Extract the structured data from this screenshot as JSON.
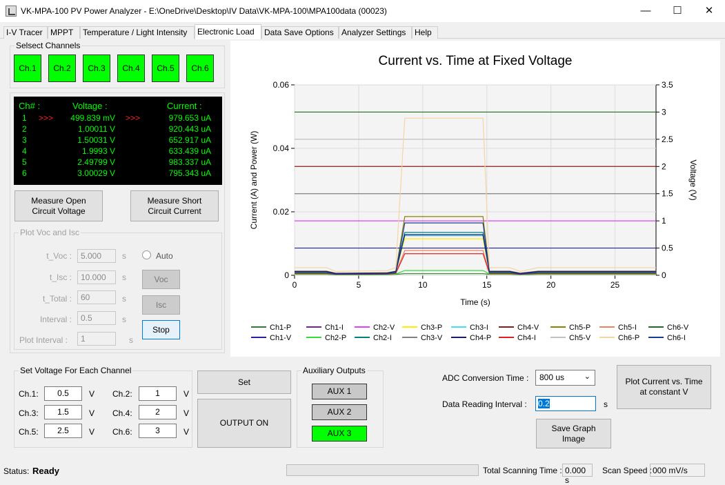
{
  "window": {
    "title": "VK-MPA-100 PV Power Analyzer - E:\\OneDrive\\Desktop\\IV Data\\VK-MPA-100\\MPA100data (00023)",
    "minimize": "—",
    "maximize": "☐",
    "close": "✕"
  },
  "tabs": [
    "I-V Tracer",
    "MPPT",
    "Temperature / Light Intensity",
    "Electronic Load",
    "Data Save Options",
    "Analyzer Settings",
    "Help"
  ],
  "active_tab": "Electronic Load",
  "channels": {
    "label": "Selsect Channels",
    "buttons": [
      "Ch.1",
      "Ch.2",
      "Ch.3",
      "Ch.4",
      "Ch.5",
      "Ch.6"
    ],
    "color": "#00ff00"
  },
  "readout": {
    "headers": {
      "ch": "Ch# :",
      "voltage": "Voltage :",
      "current": "Current :"
    },
    "rows": [
      {
        "ch": "1",
        "voltage": "499.839 mV",
        "current": "979.653 uA",
        "arrow_left": ">>>",
        "arrow_right": ">>>"
      },
      {
        "ch": "2",
        "voltage": "1.00011 V",
        "current": "920.443 uA"
      },
      {
        "ch": "3",
        "voltage": "1.50031 V",
        "current": "652.917 uA"
      },
      {
        "ch": "4",
        "voltage": "1.9993 V",
        "current": "633.439 uA"
      },
      {
        "ch": "5",
        "voltage": "2.49799 V",
        "current": "983.337 uA"
      },
      {
        "ch": "6",
        "voltage": "3.00029 V",
        "current": "795.343 uA"
      }
    ]
  },
  "measure": {
    "voc_line1": "Measure Open",
    "voc_line2": "Circuit Voltage",
    "isc_line1": "Measure Short",
    "isc_line2": "Circuit Current"
  },
  "plot_voc_isc": {
    "label": "Plot Voc and Isc",
    "t_voc_label": "t_Voc :",
    "t_voc": "5.000",
    "t_isc_label": "t_Isc :",
    "t_isc": "10.000",
    "t_total_label": "t_Total :",
    "t_total": "60",
    "interval_label": "Interval :",
    "interval": "0.5",
    "plot_interval_label": "Plot Interval :",
    "plot_interval": "1",
    "unit": "s",
    "auto_label": "Auto",
    "voc_button": "Voc",
    "isc_button": "Isc",
    "stop_button": "Stop"
  },
  "set_voltage": {
    "label": "Set Voltage For Each Channel",
    "unit": "V",
    "channels": [
      {
        "label": "Ch.1:",
        "value": "0.5"
      },
      {
        "label": "Ch.2:",
        "value": "1"
      },
      {
        "label": "Ch.3:",
        "value": "1.5"
      },
      {
        "label": "Ch.4:",
        "value": "2"
      },
      {
        "label": "Ch.5:",
        "value": "2.5"
      },
      {
        "label": "Ch.6:",
        "value": "3"
      }
    ]
  },
  "set_button": "Set",
  "output_button": "OUTPUT ON",
  "aux": {
    "label": "Auxiliary Outputs",
    "buttons": [
      "AUX 1",
      "AUX 2",
      "AUX 3"
    ],
    "active": "AUX 3"
  },
  "adc": {
    "label": "ADC Conversion Time :",
    "value": "800 us",
    "interval_label": "Data Reading Interval :",
    "interval_value": "0.2",
    "interval_unit": "s"
  },
  "plot_button_line1": "Plot Current vs. Time",
  "plot_button_line2": "at constant V",
  "save_graph_line1": "Save Graph",
  "save_graph_line2": "Image",
  "status": {
    "label": "Status:",
    "value": "Ready",
    "scan_time_label": "Total Scanning Time :",
    "scan_time": "0.000 s",
    "scan_speed_label": "Scan Speed :",
    "scan_speed": "000 mV/s"
  },
  "chart_data": {
    "type": "line",
    "title": "Current vs. Time at Fixed Voltage",
    "xlabel": "Time (s)",
    "ylabel": "Current (A) and Power (W)",
    "y2label": "Voltage (V)",
    "xlim": [
      0,
      28.2
    ],
    "ylim": [
      0,
      0.06
    ],
    "y2lim": [
      0,
      3.5
    ],
    "xticks": [
      "0",
      "5",
      "10",
      "15",
      "20",
      "25"
    ],
    "yticks": [
      "0",
      "0.02",
      "0.04",
      "0.06"
    ],
    "y2ticks": [
      "0",
      "0.5",
      "1",
      "1.5",
      "2",
      "2.5",
      "3",
      "3.5"
    ],
    "grid": true,
    "legend_placement": "bottom",
    "pulse_window": [
      8.2,
      14.8
    ],
    "series": [
      {
        "name": "Ch1-P",
        "color": "#2e7d2e",
        "axis": "left",
        "base": 0.0003,
        "peak": 0.0005
      },
      {
        "name": "Ch1-I",
        "color": "#7b1fa2",
        "axis": "left",
        "base": 0.0009,
        "peak": 0.0125
      },
      {
        "name": "Ch2-V",
        "color": "#e040fb",
        "axis": "right",
        "base": 1.0,
        "peak": 1.0
      },
      {
        "name": "Ch3-P",
        "color": "#ffee00",
        "axis": "left",
        "base": 0.001,
        "peak": 0.0115
      },
      {
        "name": "Ch3-I",
        "color": "#40e0f0",
        "axis": "left",
        "base": 0.0008,
        "peak": 0.0125
      },
      {
        "name": "Ch4-V",
        "color": "#8b1a1a",
        "axis": "right",
        "base": 2.0,
        "peak": 2.0
      },
      {
        "name": "Ch5-P",
        "color": "#8b8000",
        "axis": "left",
        "base": 0.0013,
        "peak": 0.0185
      },
      {
        "name": "Ch5-I",
        "color": "#f08060",
        "axis": "left",
        "base": 0.0009,
        "peak": 0.0078
      },
      {
        "name": "Ch6-V",
        "color": "#1b6e1b",
        "axis": "right",
        "base": 3.0,
        "peak": 3.0
      },
      {
        "name": "Ch1-V",
        "color": "#1f1fa8",
        "axis": "right",
        "base": 0.5,
        "peak": 0.5
      },
      {
        "name": "Ch2-P",
        "color": "#33dd33",
        "axis": "left",
        "base": 0.0004,
        "peak": 0.0015
      },
      {
        "name": "Ch2-I",
        "color": "#008080",
        "axis": "left",
        "base": 0.0009,
        "peak": 0.0135
      },
      {
        "name": "Ch3-V",
        "color": "#808080",
        "axis": "right",
        "base": 1.5,
        "peak": 1.5
      },
      {
        "name": "Ch4-P",
        "color": "#191970",
        "axis": "left",
        "base": 0.0012,
        "peak": 0.0128
      },
      {
        "name": "Ch4-I",
        "color": "#e02020",
        "axis": "left",
        "base": 0.0006,
        "peak": 0.0068
      },
      {
        "name": "Ch5-V",
        "color": "#c0c0c0",
        "axis": "right",
        "base": 2.5,
        "peak": 2.5
      },
      {
        "name": "Ch6-P",
        "color": "#f5d5a0",
        "axis": "left",
        "base": 0.0024,
        "peak": 0.0495
      },
      {
        "name": "Ch6-I",
        "color": "#1a3a9a",
        "axis": "left",
        "base": 0.0008,
        "peak": 0.0165
      }
    ]
  }
}
